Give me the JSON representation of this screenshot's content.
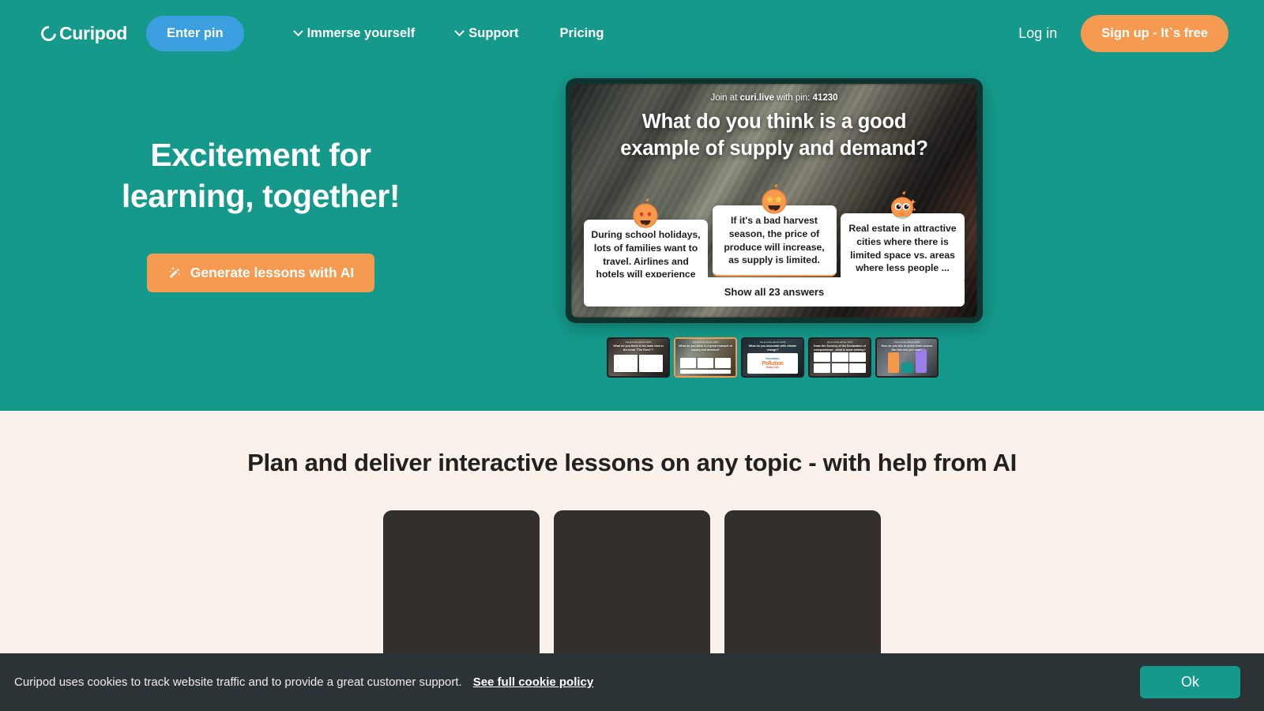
{
  "brand": {
    "name": "Curipod",
    "teal": "#14998a",
    "orange": "#f49b51",
    "blue": "#3b9fe0",
    "cream": "#faf1eb",
    "dark": "#2c3336"
  },
  "nav": {
    "logo_text": "Curipod",
    "enter_pin_label": "Enter pin",
    "links": [
      {
        "label": "Immerse yourself",
        "has_chevron": true
      },
      {
        "label": "Support",
        "has_chevron": true
      },
      {
        "label": "Pricing",
        "has_chevron": false
      }
    ],
    "login_label": "Log in",
    "signup_label": "Sign up - It`s free"
  },
  "hero": {
    "title_line1": "Excitement for",
    "title_line2": "learning, together!",
    "cta_label": "Generate lessons with AI",
    "cta_icon": "magic-wand-icon"
  },
  "slide": {
    "join_prefix": "Join at ",
    "join_domain": "curi.live",
    "join_middle": " with pin: ",
    "pin": "41230",
    "question": "What do you think is a good example of supply and demand?",
    "answers": [
      {
        "text": "During school holidays, lots of families want to travel. Airlines and hotels will experience ...",
        "mascot": "heart-eyes-mascot-icon",
        "accent": "#2aa79b"
      },
      {
        "text": "If it's a bad harvest season, the price of produce will increase, as supply is limited.",
        "mascot": "star-struck-mascot-icon",
        "accent": "#f49b51"
      },
      {
        "text": "Real estate in attractive cities where there is limited space vs. areas where less people ...",
        "mascot": "sparkle-shy-mascot-icon",
        "accent": "#4aa8e0"
      }
    ],
    "show_all_label": "Show all 23 answers",
    "answer_count": 23
  },
  "thumbnails": [
    {
      "id": "thumb-1",
      "title": "What do you think is the main idea in the book \"The Giver\"?",
      "pin_line": "Join at curi.live with pin: 41230",
      "active": false
    },
    {
      "id": "thumb-2",
      "title": "What do you think is a good example of supply and demand?",
      "pin_line": "Join at curi.live with pin: 41230",
      "active": true
    },
    {
      "id": "thumb-3",
      "title": "What do you associate with climate change?",
      "pin_line": "Join at curi.live with pin: 41230",
      "active": false
    },
    {
      "id": "thumb-4",
      "title": "Draw the Scenery of the Declaration of Independence - what is most striking?",
      "pin_line": "Join at curi.live with pin: 41230",
      "active": false
    },
    {
      "id": "thumb-5",
      "title": "How do you like to solve short stories like this one you read?",
      "pin_line": "Join at curi.live with pin: 41230",
      "active": false
    }
  ],
  "features": {
    "heading": "Plan and deliver interactive lessons on any topic - with help from AI",
    "cards": [
      {
        "id": "feature-card-1"
      },
      {
        "id": "feature-card-2"
      },
      {
        "id": "feature-card-3"
      }
    ]
  },
  "cookie": {
    "text": "Curipod uses cookies to track website traffic and to provide a great customer support.",
    "link_label": "See full cookie policy",
    "ok_label": "Ok"
  }
}
